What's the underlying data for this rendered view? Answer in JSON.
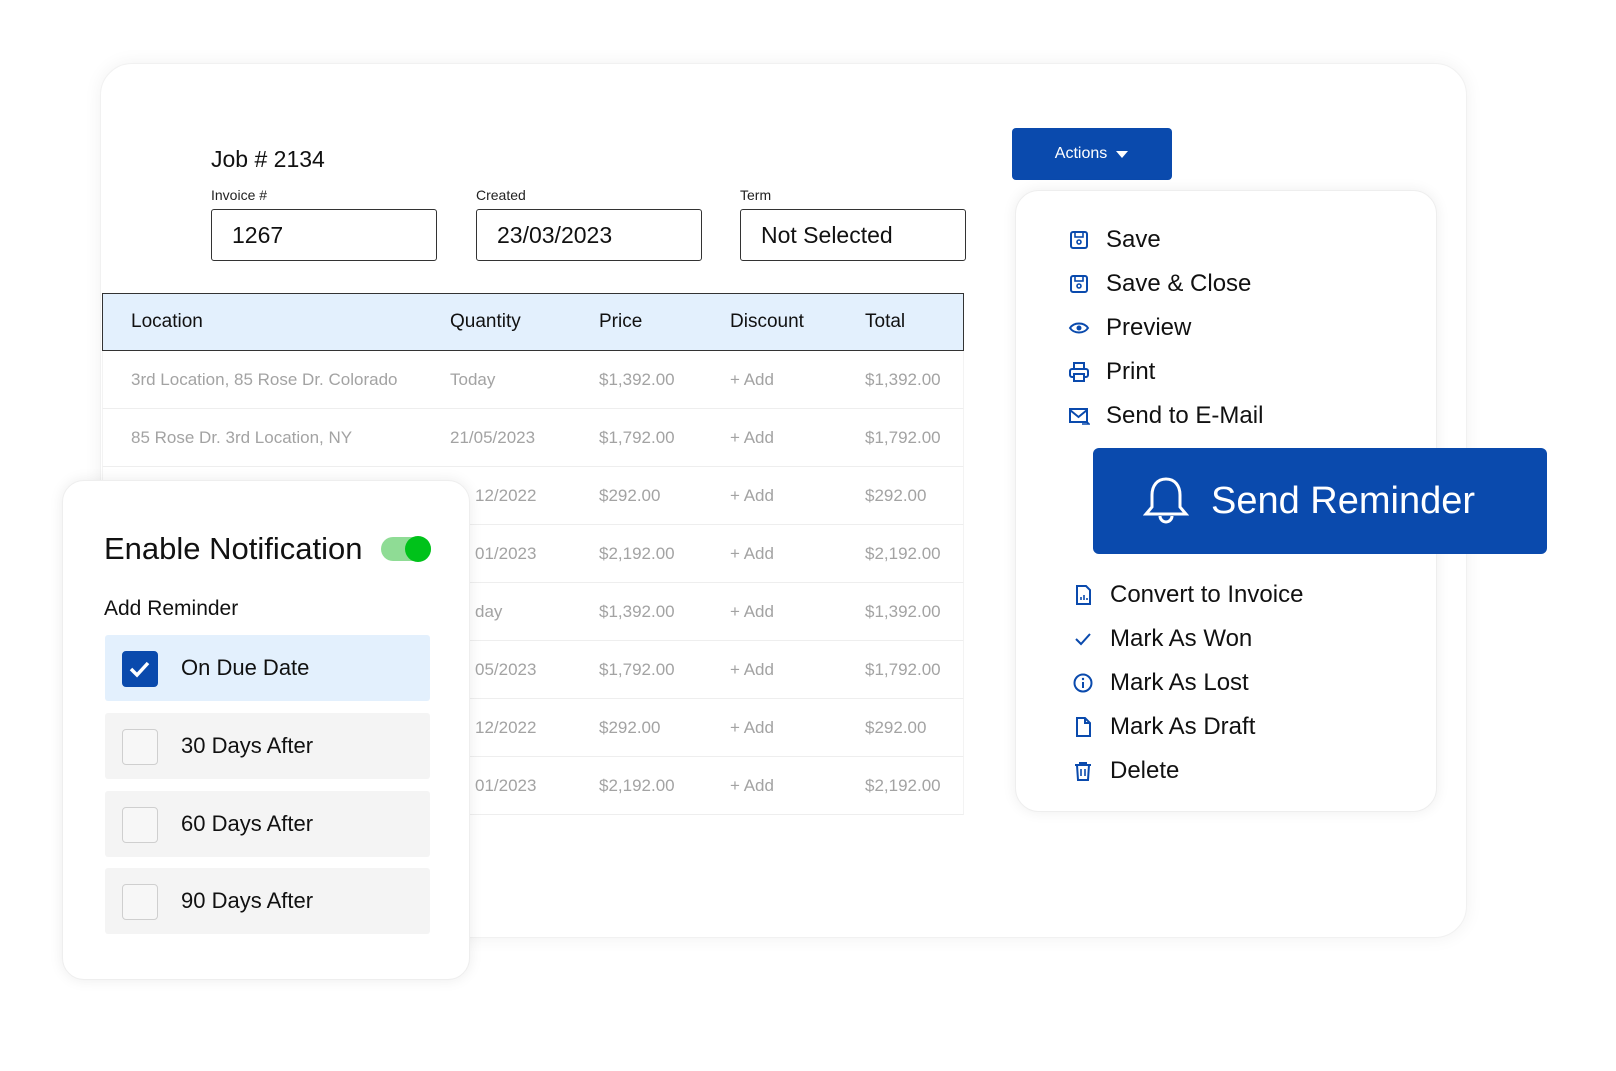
{
  "job": {
    "title": "Job # 2134",
    "fields": [
      {
        "label": "Invoice #",
        "value": "1267"
      },
      {
        "label": "Created",
        "value": "23/03/2023"
      },
      {
        "label": "Term",
        "value": "Not Selected"
      }
    ]
  },
  "table": {
    "headers": [
      "Location",
      "Quantity",
      "Price",
      "Discount",
      "Total"
    ],
    "rows": [
      [
        "3rd Location, 85 Rose Dr. Colorado",
        "Today",
        "$1,392.00",
        "+ Add",
        "$1,392.00"
      ],
      [
        "85 Rose Dr. 3rd Location, NY",
        "21/05/2023",
        "$1,792.00",
        "+ Add",
        "$1,792.00"
      ],
      [
        "",
        "12/2022",
        "$292.00",
        "+ Add",
        "$292.00"
      ],
      [
        "",
        "01/2023",
        "$2,192.00",
        "+ Add",
        "$2,192.00"
      ],
      [
        "",
        "day",
        "$1,392.00",
        "+ Add",
        "$1,392.00"
      ],
      [
        "",
        "05/2023",
        "$1,792.00",
        "+ Add",
        "$1,792.00"
      ],
      [
        "",
        "12/2022",
        "$292.00",
        "+ Add",
        "$292.00"
      ],
      [
        "",
        "01/2023",
        "$2,192.00",
        "+ Add",
        "$2,192.00"
      ]
    ]
  },
  "notification": {
    "title": "Enable Notification",
    "toggle_on": true,
    "toggle_color": "#00c21a",
    "subtitle": "Add Reminder",
    "options": [
      {
        "label": "On Due Date",
        "checked": true
      },
      {
        "label": "30 Days After",
        "checked": false
      },
      {
        "label": "60 Days After",
        "checked": false
      },
      {
        "label": "90 Days After",
        "checked": false
      }
    ]
  },
  "actions": {
    "label": "Actions",
    "accent": "#0a4aad",
    "menu_top": [
      {
        "label": "Save",
        "icon": "save-icon"
      },
      {
        "label": "Save & Close",
        "icon": "save-icon"
      },
      {
        "label": "Preview",
        "icon": "eye-icon"
      },
      {
        "label": "Print",
        "icon": "printer-icon"
      },
      {
        "label": "Send to E-Mail",
        "icon": "mail-send-icon"
      }
    ],
    "reminder": {
      "label": "Send Reminder",
      "icon": "bell-icon"
    },
    "menu_bottom": [
      {
        "label": "Convert to Invoice",
        "icon": "invoice-icon"
      },
      {
        "label": "Mark As Won",
        "icon": "check-icon"
      },
      {
        "label": "Mark As Lost",
        "icon": "info-icon"
      },
      {
        "label": "Mark As Draft",
        "icon": "file-icon"
      },
      {
        "label": "Delete",
        "icon": "trash-icon"
      }
    ]
  }
}
